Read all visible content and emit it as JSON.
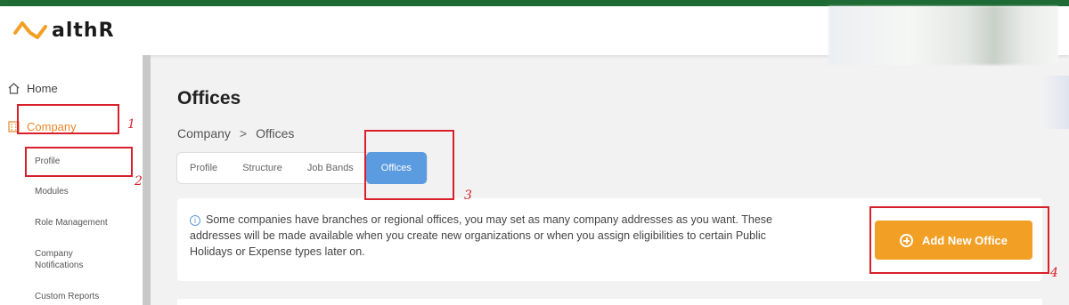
{
  "app": {
    "logo_text": "althR"
  },
  "sidebar": {
    "home_label": "Home",
    "company_label": "Company",
    "sub_items": [
      "Profile",
      "Modules",
      "Role Management",
      "Company Notifications",
      "Custom Reports"
    ]
  },
  "main": {
    "title": "Offices",
    "breadcrumb": {
      "parent": "Company",
      "separator": ">",
      "current": "Offices"
    },
    "tabs": [
      {
        "label": "Profile",
        "active": false
      },
      {
        "label": "Structure",
        "active": false
      },
      {
        "label": "Job Bands",
        "active": false
      },
      {
        "label": "Offices",
        "active": true
      }
    ],
    "info": {
      "icon": "info-icon",
      "text": "Some companies have branches or regional offices, you may set as many company addresses as you want. These addresses will be made available when you create new organizations or when you assign eligibilities to certain Public Holidays or Expense types later on."
    },
    "add_button_label": "Add New Office"
  },
  "annotations": [
    "1",
    "2",
    "3",
    "4"
  ],
  "colors": {
    "brand_green": "#1f6b35",
    "accent_orange": "#f2a025",
    "active_tab_blue": "#5b9be0",
    "annotation_red": "#d9202a"
  }
}
